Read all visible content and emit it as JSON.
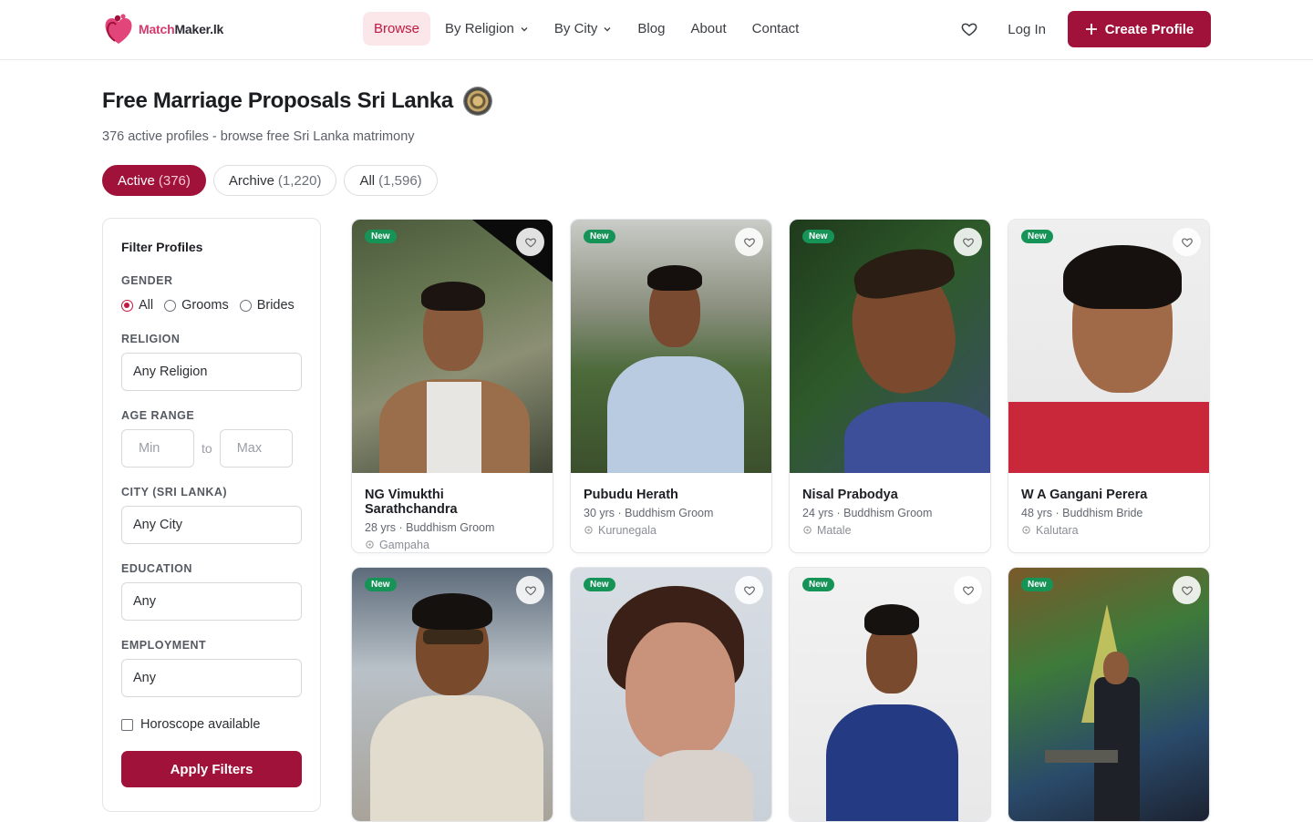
{
  "brand": {
    "name_part1": "Match",
    "name_part2": "Maker.lk"
  },
  "nav": {
    "items": [
      {
        "label": "Browse",
        "active": true,
        "dropdown": false
      },
      {
        "label": "By Religion",
        "active": false,
        "dropdown": true
      },
      {
        "label": "By City",
        "active": false,
        "dropdown": true
      },
      {
        "label": "Blog",
        "active": false,
        "dropdown": false
      },
      {
        "label": "About",
        "active": false,
        "dropdown": false
      },
      {
        "label": "Contact",
        "active": false,
        "dropdown": false
      }
    ],
    "login": "Log In",
    "create_profile": "Create Profile"
  },
  "page": {
    "title": "Free Marriage Proposals Sri Lanka",
    "subtitle": "376 active profiles - browse free Sri Lanka matrimony"
  },
  "tabs": [
    {
      "label": "Active",
      "count": "(376)",
      "active": true
    },
    {
      "label": "Archive",
      "count": "(1,220)",
      "active": false
    },
    {
      "label": "All",
      "count": "(1,596)",
      "active": false
    }
  ],
  "filters": {
    "title": "Filter Profiles",
    "gender_label": "GENDER",
    "gender_options": [
      "All",
      "Grooms",
      "Brides"
    ],
    "gender_selected": "All",
    "religion_label": "RELIGION",
    "religion_value": "Any Religion",
    "age_label": "AGE RANGE",
    "age_min_placeholder": "Min",
    "age_to": "to",
    "age_max_placeholder": "Max",
    "city_label": "CITY (SRI LANKA)",
    "city_value": "Any City",
    "education_label": "EDUCATION",
    "education_value": "Any",
    "employment_label": "EMPLOYMENT",
    "employment_value": "Any",
    "horoscope_label": "Horoscope available",
    "apply_label": "Apply Filters"
  },
  "profiles": [
    {
      "badge": "New",
      "name": "NG Vimukthi Sarathchandra",
      "meta": "28 yrs · Buddhism Groom",
      "city": "Gampaha"
    },
    {
      "badge": "New",
      "name": "Pubudu Herath",
      "meta": "30 yrs · Buddhism Groom",
      "city": "Kurunegala"
    },
    {
      "badge": "New",
      "name": "Nisal Prabodya",
      "meta": "24 yrs · Buddhism Groom",
      "city": "Matale"
    },
    {
      "badge": "New",
      "name": "W A Gangani Perera",
      "meta": "48 yrs · Buddhism Bride",
      "city": "Kalutara"
    },
    {
      "badge": "New",
      "name": "",
      "meta": "",
      "city": ""
    },
    {
      "badge": "New",
      "name": "",
      "meta": "",
      "city": ""
    },
    {
      "badge": "New",
      "name": "",
      "meta": "",
      "city": ""
    },
    {
      "badge": "New",
      "name": "",
      "meta": "",
      "city": ""
    }
  ],
  "colors": {
    "brand": "#a1123a",
    "new_badge": "#169458",
    "nav_active_bg": "#fbe7ea"
  }
}
